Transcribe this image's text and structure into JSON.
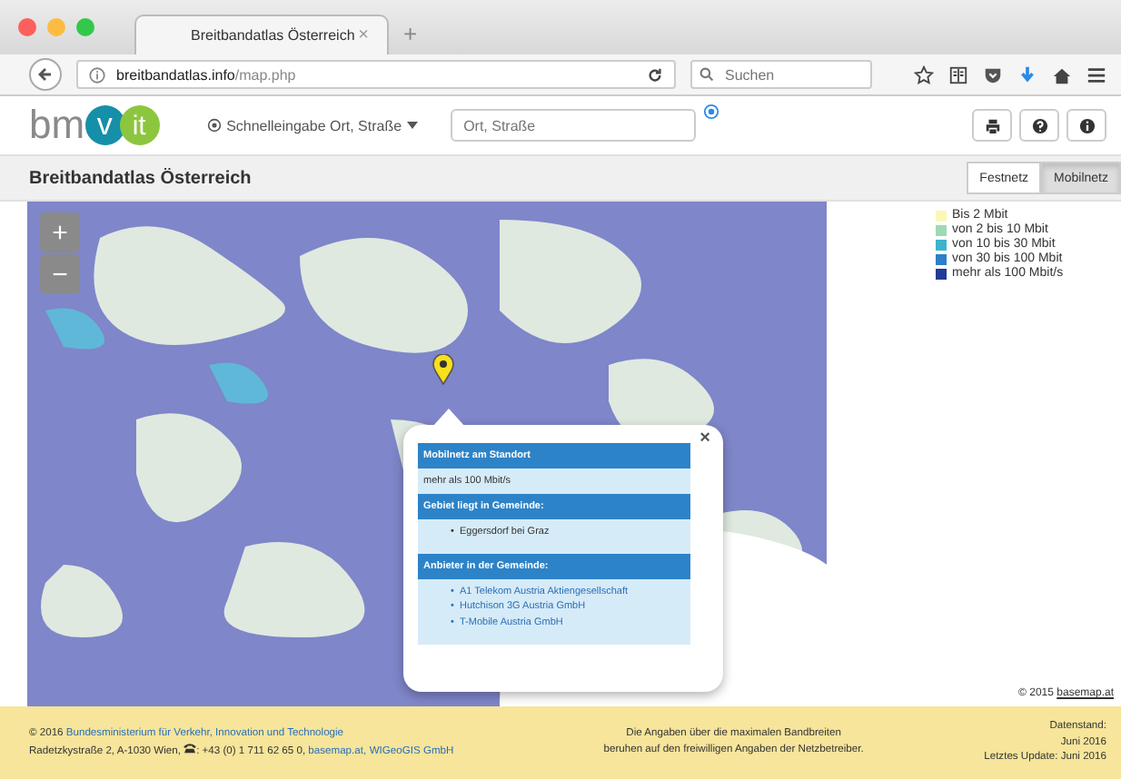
{
  "browser": {
    "tab_title": "Breitbandatlas Österreich",
    "tab_close": "×",
    "new_tab": "+",
    "url_domain": "breitbandatlas.info",
    "url_path": "/map.php",
    "search_placeholder": "Suchen"
  },
  "header": {
    "logo": [
      "bm",
      "v",
      "it"
    ],
    "quick_search": "Schnelleingabe Ort, Straße",
    "place_placeholder": "Ort, Straße"
  },
  "title": "Breitbandatlas Österreich",
  "network_tabs": [
    {
      "label": "Festnetz",
      "selected": false
    },
    {
      "label": "Mobilnetz",
      "selected": true
    }
  ],
  "zoom": {
    "in": "+",
    "out": "−"
  },
  "legend": [
    {
      "label": "Bis 2 Mbit",
      "color": "#fbf7b4"
    },
    {
      "label": "von 2 bis 10 Mbit",
      "color": "#9fd9b4"
    },
    {
      "label": "von 10 bis 30 Mbit",
      "color": "#3cb4cc"
    },
    {
      "label": "von 30 bis 100 Mbit",
      "color": "#2c7fc8"
    },
    {
      "label": "mehr als 100 Mbit/s",
      "color": "#233a96"
    }
  ],
  "popup": {
    "close": "×",
    "bullet": "•",
    "sections": [
      {
        "heading": "Mobilnetz am Standort",
        "kind": "text",
        "items": [
          "mehr als 100 Mbit/s"
        ]
      },
      {
        "heading": "Gebiet liegt in Gemeinde:",
        "kind": "list",
        "items": [
          "Eggersdorf bei Graz"
        ]
      },
      {
        "heading": "Anbieter in der Gemeinde:",
        "kind": "links",
        "items": [
          "A1 Telekom Austria Aktiengesellschaft",
          "Hutchison 3G Austria GmbH",
          "T-Mobile Austria GmbH"
        ]
      }
    ]
  },
  "attribution": {
    "prefix": "© 2015",
    "link": "basemap.at"
  },
  "footer": {
    "left": [
      [
        {
          "kind": "text",
          "text": "© 2016 "
        },
        {
          "kind": "link",
          "text": "Bundesministerium für Verkehr, Innovation und Technologie"
        }
      ],
      [
        {
          "kind": "text",
          "text": "Radetzkystraße 2, A-1030 Wien, "
        },
        {
          "kind": "icon"
        },
        {
          "kind": "text",
          "text": ": +43 (0) 1 711 62 65 0, "
        },
        {
          "kind": "link",
          "text": "basemap.at,"
        },
        {
          "kind": "link",
          "text": "WIGeoGIS GmbH"
        }
      ]
    ],
    "center": [
      "Die Angaben über die maximalen Bandbreiten",
      "beruhen auf den freiwilligen Angaben der Netzbetreiber."
    ],
    "right": [
      "Datenstand:",
      "Juni 2016",
      "Letztes Update: Juni 2016"
    ]
  }
}
